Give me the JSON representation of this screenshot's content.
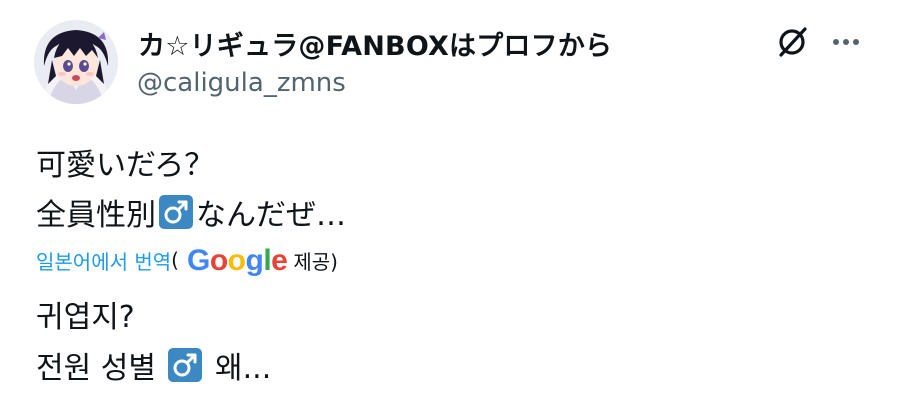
{
  "author": {
    "display_name": "カ☆リギュラ@FANBOXはプロフから",
    "handle": "@caligula_zmns"
  },
  "tweet": {
    "original_line1": "可愛いだろ？",
    "original_line2_before_emoji": "全員性別",
    "original_line2_after_emoji": "なんだぜ…",
    "translated_line1": "귀엽지?",
    "translated_line2_before_emoji": "전원 성별 ",
    "translated_line2_after_emoji": " 왜..."
  },
  "translation": {
    "link_label": "일본어에서 번역",
    "open_paren": "(",
    "provider_suffix": "제공)",
    "google_letters": [
      "G",
      "o",
      "o",
      "g",
      "l",
      "e"
    ]
  },
  "icons": {
    "male_sign_emoji": "male-sign-emoji-icon",
    "grok": "grok-icon",
    "more": "more-options-icon"
  },
  "colors": {
    "link": "#1d9bf0",
    "secondary_text": "#536471",
    "emoji_background": "#3b88c3"
  }
}
